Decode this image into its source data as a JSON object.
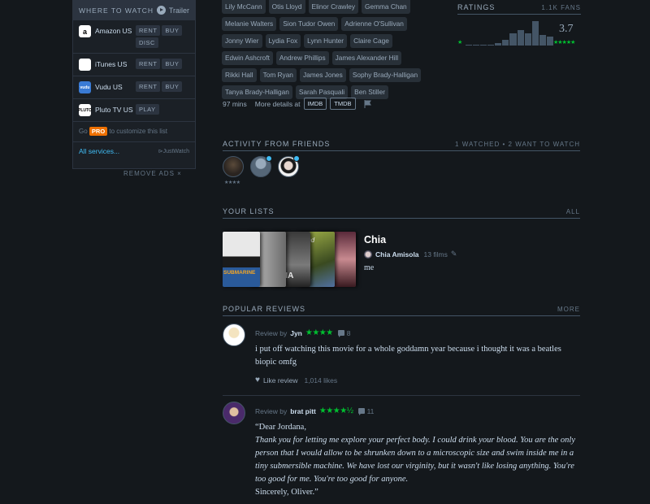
{
  "where_to_watch": {
    "title": "WHERE TO WATCH",
    "trailer": "Trailer",
    "services": [
      {
        "name": "Amazon US",
        "icon": "amazon-icon",
        "buttons": [
          "RENT",
          "BUY",
          "DISC"
        ]
      },
      {
        "name": "iTunes US",
        "icon": "apple-icon",
        "buttons": [
          "RENT",
          "BUY"
        ]
      },
      {
        "name": "Vudu US",
        "icon": "vudu-icon",
        "buttons": [
          "RENT",
          "BUY"
        ]
      },
      {
        "name": "Pluto TV US",
        "icon": "pluto-icon",
        "buttons": [
          "PLAY"
        ]
      }
    ],
    "go": "Go",
    "pro": "PRO",
    "customize": "to customize this list",
    "all_services": "All services...",
    "justwatch": "JustWatch",
    "remove_ads": "REMOVE ADS ×"
  },
  "cast": [
    "Lily McCann",
    "Otis Lloyd",
    "Elinor Crawley",
    "Gemma Chan",
    "Melanie Walters",
    "Sion Tudor Owen",
    "Adrienne O'Sullivan",
    "Jonny Wier",
    "Lydia Fox",
    "Lynn Hunter",
    "Claire Cage",
    "Edwin Ashcroft",
    "Andrew Phillips",
    "James Alexander Hill",
    "Rikki Hall",
    "Tom Ryan",
    "James Jones",
    "Sophy Brady-Halligan",
    "Tanya Brady-Halligan",
    "Sarah Pasquali",
    "Ben Stiller"
  ],
  "meta": {
    "runtime": "97 mins",
    "more_details": "More details at",
    "imdb": "IMDB",
    "tmdb": "TMDB"
  },
  "ratings": {
    "title": "RATINGS",
    "fans": "1.1K FANS",
    "average": "3.7",
    "low_star": "★",
    "high_stars": "★★★★★",
    "histogram": [
      0.03,
      0.03,
      0.03,
      0.05,
      0.1,
      0.22,
      0.5,
      0.62,
      0.5,
      1.0,
      0.42,
      0.36
    ]
  },
  "friends": {
    "title": "ACTIVITY FROM FRIENDS",
    "summary": "1 WATCHED • 2 WANT TO WATCH",
    "first_rating": "★★★★"
  },
  "lists": {
    "title": "YOUR LISTS",
    "all": "ALL",
    "list_name": "Chia",
    "owner": "Chia Amisola",
    "films": "13 films",
    "description": "me",
    "poster_texts": [
      "SUBMARINE",
      "OMA",
      "Hood"
    ]
  },
  "reviews": {
    "title": "POPULAR REVIEWS",
    "more": "MORE",
    "review_by": "Review by",
    "items": [
      {
        "user": "Jyn",
        "stars": "★★★★",
        "comments": "8",
        "text": "i put off watching this movie for a whole goddamn year because i thought it was a beatles biopic omfg",
        "like_label": "Like review",
        "likes": "1,014 likes"
      },
      {
        "user": "brat pitt",
        "stars": "★★★★½",
        "comments": "11",
        "opening": "“Dear Jordana,",
        "body": "Thank you for letting me explore your perfect body. I could drink your blood. You are the only person that I would allow to be shrunken down to a microscopic size and swim inside me in a tiny submersible machine. We have lost our virginity, but it wasn't like losing anything. You're too good for me. You're too good for anyone.",
        "closing": "Sincerely, Oliver.”"
      }
    ]
  },
  "colors": {
    "background": "#14181c",
    "accent_green": "#00c030",
    "link_blue": "#40bcf4",
    "pro_orange": "#ee7000"
  }
}
